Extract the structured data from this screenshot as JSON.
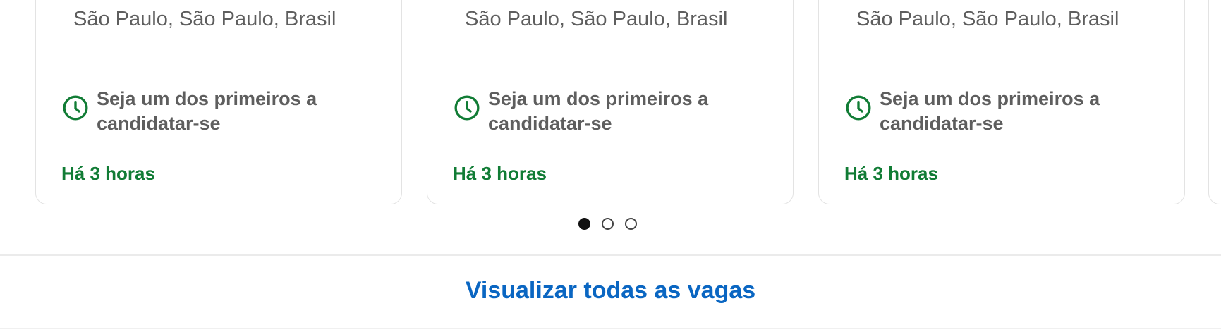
{
  "jobs_carousel": {
    "cards": [
      {
        "location": "São Paulo, São Paulo, Brasil",
        "insight": "Seja um dos primeiros a candidatar-se",
        "posted": "Há 3 horas"
      },
      {
        "location": "São Paulo, São Paulo, Brasil",
        "insight": "Seja um dos primeiros a candidatar-se",
        "posted": "Há 3 horas"
      },
      {
        "location": "São Paulo, São Paulo, Brasil",
        "insight": "Seja um dos primeiros a candidatar-se",
        "posted": "Há 3 horas"
      }
    ],
    "pagination": {
      "total": 3,
      "active_index": 0
    }
  },
  "footer": {
    "view_all_label": "Visualizar todas as vagas"
  },
  "icons": {
    "insight_icon": "clock-icon"
  },
  "colors": {
    "accent_green": "#117c35",
    "link_blue": "#0a66c2",
    "text_secondary": "#5e5e5e"
  }
}
